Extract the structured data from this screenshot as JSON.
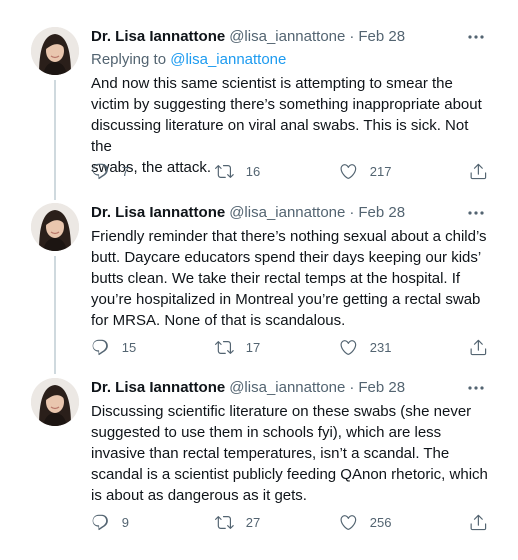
{
  "tweets": [
    {
      "author_name": "Dr. Lisa Iannattone",
      "handle": "@lisa_iannattone",
      "separator": "·",
      "date": "Feb 28",
      "replying_prefix": "Replying to ",
      "replying_to": "@lisa_iannattone",
      "lines": [
        "And now this same scientist is attempting to smear the",
        "victim by suggesting there’s something inappropriate about",
        "discussing literature on viral anal swabs. This is sick. Not the",
        "swabs, the attack."
      ],
      "replies": "7",
      "retweets": "16",
      "likes": "217"
    },
    {
      "author_name": "Dr. Lisa Iannattone",
      "handle": "@lisa_iannattone",
      "separator": "·",
      "date": "Feb 28",
      "lines": [
        "Friendly reminder that there’s nothing sexual about a child’s",
        "butt. Daycare educators spend their days keeping our kids’",
        "butts clean. We take their rectal temps at the hospital. If",
        "you’re hospitalized in Montreal you’re getting a rectal swab",
        "for MRSA. None of that is scandalous."
      ],
      "replies": "15",
      "retweets": "17",
      "likes": "231"
    },
    {
      "author_name": "Dr. Lisa Iannattone",
      "handle": "@lisa_iannattone",
      "separator": "·",
      "date": "Feb 28",
      "lines": [
        "Discussing scientific literature on these swabs (she never",
        "suggested to use them in schools fyi), which are less",
        "invasive than rectal temperatures, isn’t a scandal. The",
        "scandal is a scientist publicly feeding QAnon rhetoric, which",
        "is about as dangerous as it gets."
      ],
      "replies": "9",
      "retweets": "27",
      "likes": "256"
    }
  ],
  "icons": {
    "more": "more-horizontal-icon",
    "reply": "reply-icon",
    "retweet": "retweet-icon",
    "like": "heart-icon",
    "share": "share-icon"
  },
  "colors": {
    "text": "#0f1419",
    "secondary": "#536471",
    "link": "#1d9bf0",
    "thread_line": "#cfd9de"
  }
}
